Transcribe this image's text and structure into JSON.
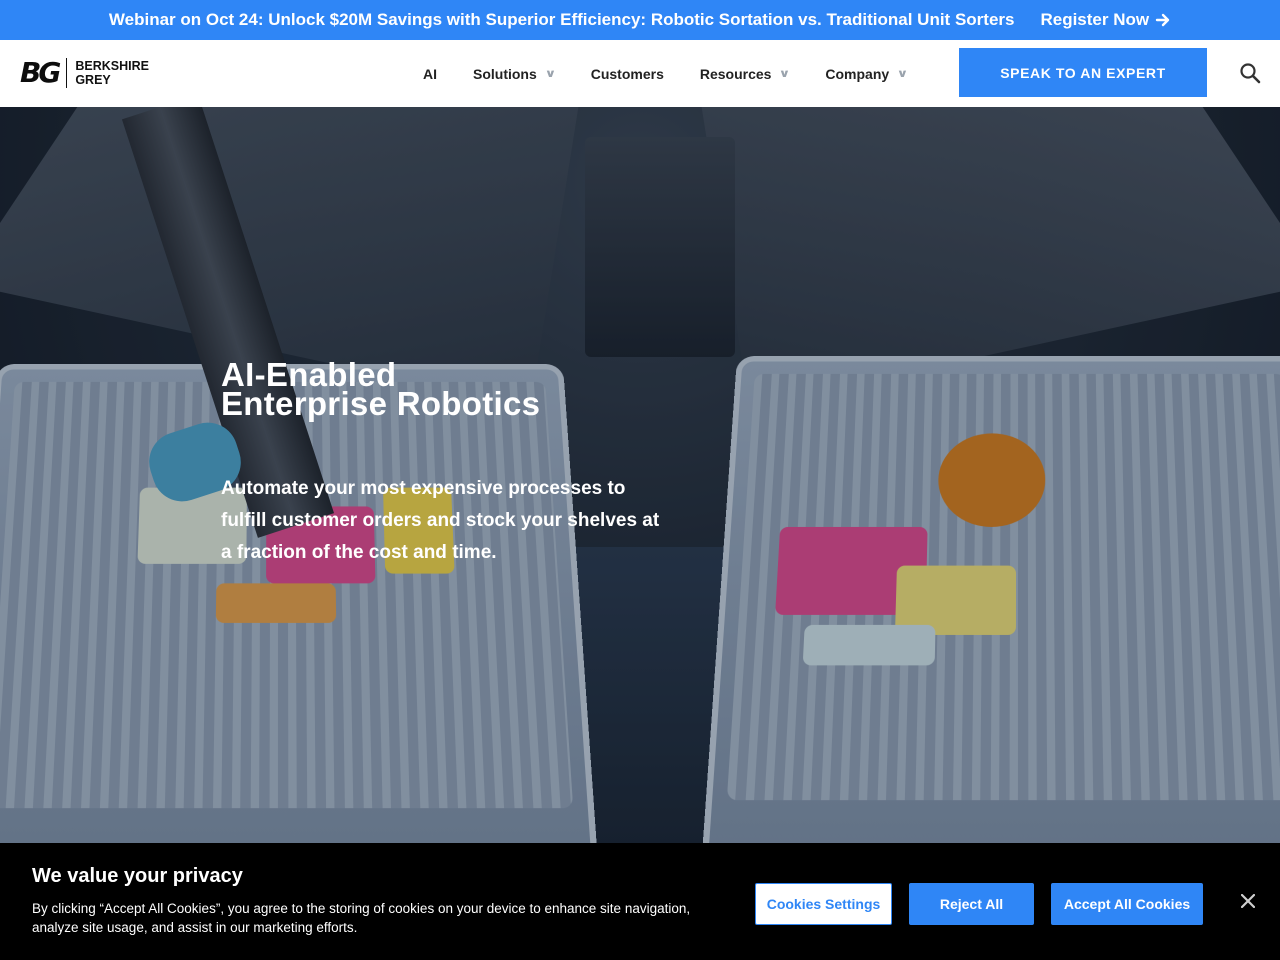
{
  "announcement": {
    "text": "Webinar on Oct 24: Unlock $20M Savings with Superior Efficiency: Robotic Sortation vs. Traditional Unit Sorters",
    "link_label": "Register Now",
    "link_icon": "arrow-right-icon",
    "background": "#2f86f6"
  },
  "header": {
    "logo": {
      "mark": "BG",
      "line1": "BERKSHIRE",
      "line2": "GREY"
    },
    "nav": [
      {
        "label": "AI",
        "has_dropdown": false
      },
      {
        "label": "Solutions",
        "has_dropdown": true
      },
      {
        "label": "Customers",
        "has_dropdown": false
      },
      {
        "label": "Resources",
        "has_dropdown": true
      },
      {
        "label": "Company",
        "has_dropdown": true
      }
    ],
    "dropdown_icon": "chevron-down-icon",
    "cta_label": "SPEAK TO AN EXPERT",
    "search_icon": "search-icon",
    "accent": "#2f86f6"
  },
  "hero": {
    "title_line1": "AI-Enabled",
    "title_line2": "Enterprise Robotics",
    "subtitle": "Automate your most expensive processes to fulfill customer orders and stock your shelves at a fraction of the cost and time."
  },
  "cookie_banner": {
    "title": "We value your privacy",
    "text": "By clicking “Accept All Cookies”, you agree to the storing of cookies on your device to enhance site navigation, analyze site usage, and assist in our marketing efforts.",
    "settings_label": "Cookies Settings",
    "reject_label": "Reject All",
    "accept_label": "Accept All Cookies",
    "close_icon": "close-icon"
  }
}
